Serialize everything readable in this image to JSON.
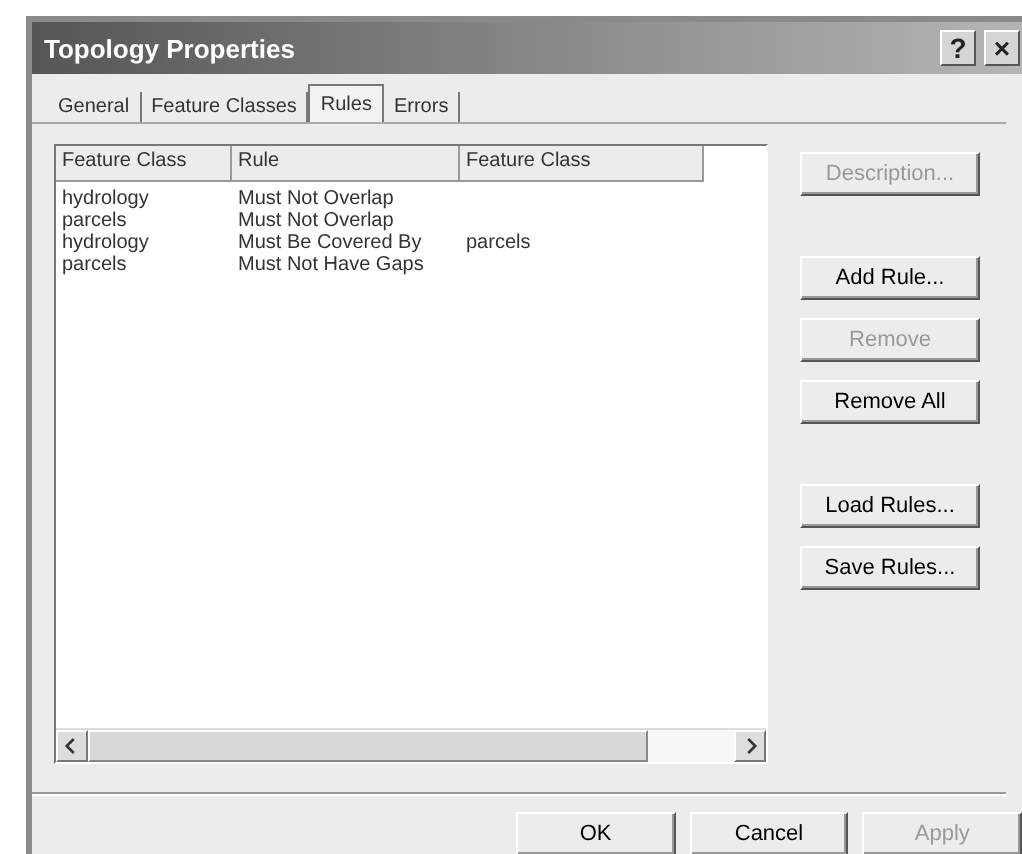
{
  "window": {
    "title": "Topology Properties",
    "buttons": [
      {
        "label": "?"
      },
      {
        "label": "×"
      }
    ]
  },
  "tabs": [
    {
      "label": "General",
      "selected": false
    },
    {
      "label": "Feature Classes",
      "selected": false
    },
    {
      "label": "Rules",
      "selected": true
    },
    {
      "label": "Errors",
      "selected": false
    }
  ],
  "table": {
    "columns": [
      "Feature Class",
      "Rule",
      "Feature Class"
    ],
    "rows": [
      [
        "hydrology",
        "Must Not Overlap",
        ""
      ],
      [
        "parcels",
        "Must Not Overlap",
        ""
      ],
      [
        "hydrology",
        "Must Be Covered By",
        "parcels"
      ],
      [
        "parcels",
        "Must Not Have Gaps",
        ""
      ]
    ]
  },
  "side_button_groups": [
    [
      {
        "label": "Description...",
        "disabled": true
      }
    ],
    [
      {
        "label": "Add Rule...",
        "disabled": false
      },
      {
        "label": "Remove",
        "disabled": true
      },
      {
        "label": "Remove All",
        "disabled": false
      }
    ],
    [
      {
        "label": "Load Rules...",
        "disabled": false
      },
      {
        "label": "Save Rules...",
        "disabled": false
      }
    ]
  ],
  "footer_buttons": [
    {
      "label": "OK",
      "disabled": false
    },
    {
      "label": "Cancel",
      "disabled": false
    },
    {
      "label": "Apply",
      "disabled": true
    }
  ]
}
